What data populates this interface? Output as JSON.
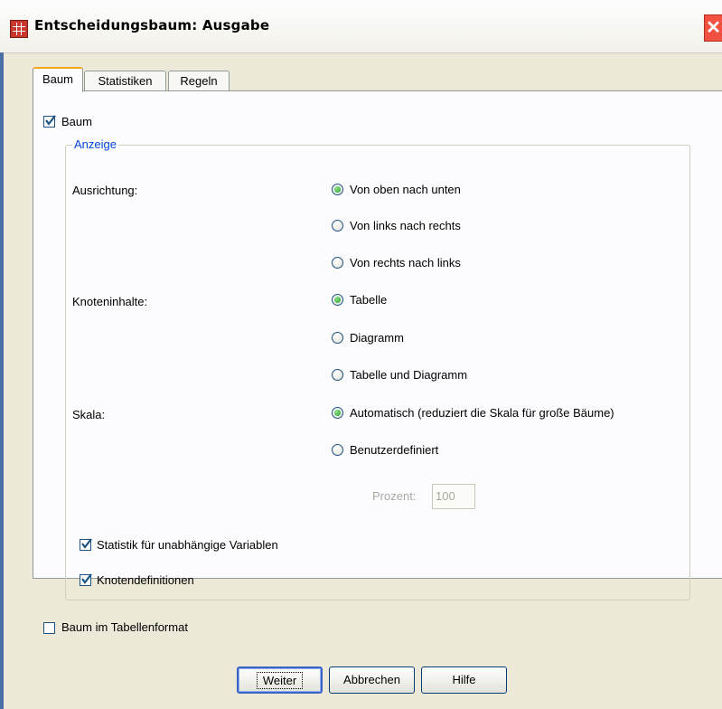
{
  "window": {
    "title": "Entscheidungsbaum: Ausgabe"
  },
  "tabs": [
    {
      "label": "Baum",
      "active": true
    },
    {
      "label": "Statistiken",
      "active": false
    },
    {
      "label": "Regeln",
      "active": false
    }
  ],
  "tree_checkbox": {
    "label": "Baum",
    "checked": true
  },
  "display_group": {
    "title": "Anzeige",
    "orientation": {
      "label": "Ausrichtung:",
      "options": [
        {
          "label": "Von oben nach unten",
          "selected": true
        },
        {
          "label": "Von links nach rechts",
          "selected": false
        },
        {
          "label": "Von rechts nach links",
          "selected": false
        }
      ]
    },
    "node_contents": {
      "label": "Knoteninhalte:",
      "options": [
        {
          "label": "Tabelle",
          "selected": true
        },
        {
          "label": "Diagramm",
          "selected": false
        },
        {
          "label": "Tabelle und Diagramm",
          "selected": false
        }
      ]
    },
    "scale": {
      "label": "Skala:",
      "options": [
        {
          "label": "Automatisch (reduziert die Skala für große Bäume)",
          "selected": true
        },
        {
          "label": "Benutzerdefiniert",
          "selected": false
        }
      ],
      "percent_label": "Prozent:",
      "percent_value": "100"
    },
    "stats_independent": {
      "label": "Statistik für unabhängige Variablen",
      "checked": true
    },
    "node_definitions": {
      "label": "Knotendefinitionen",
      "checked": true
    }
  },
  "table_format": {
    "label": "Baum im Tabellenformat",
    "checked": false
  },
  "buttons": {
    "continue": "Weiter",
    "cancel": "Abbrechen",
    "help": "Hilfe"
  },
  "colors": {
    "accent_tab": "#f5a623",
    "group_title": "#0046d5",
    "close_button": "#f25040"
  }
}
